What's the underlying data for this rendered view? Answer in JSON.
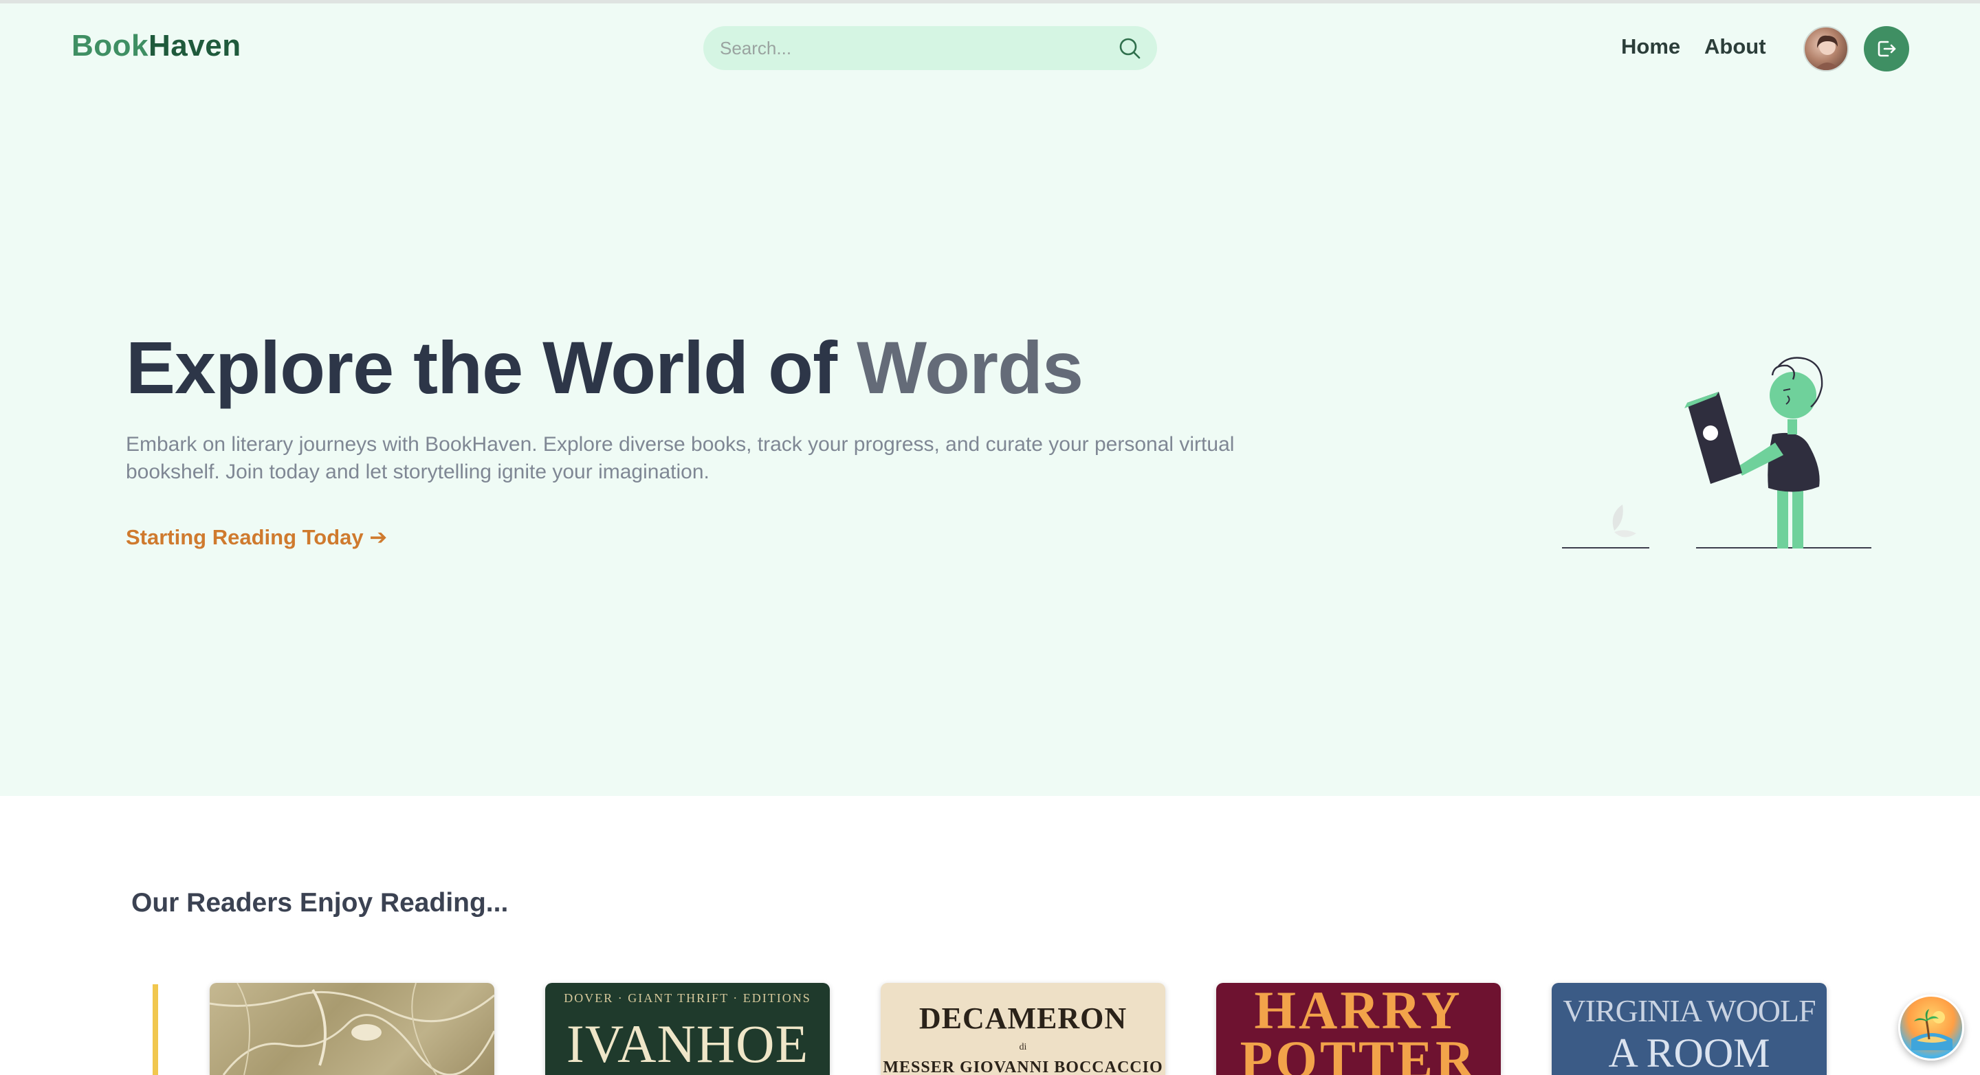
{
  "navbar": {
    "logo_part1": "Book",
    "logo_part2": "Haven",
    "search_placeholder": "Search...",
    "links": [
      {
        "label": "Home"
      },
      {
        "label": "About"
      }
    ],
    "avatar_icon": "user-avatar",
    "logout_icon": "logout-icon",
    "search_icon": "search-icon"
  },
  "hero": {
    "title_main": "Explore the World of ",
    "title_highlight": "Words",
    "description": "Embark on literary journeys with BookHaven. Explore diverse books, track your progress, and curate your personal virtual bookshelf. Join today and let storytelling ignite your imagination.",
    "cta_label": "Starting Reading Today ➔",
    "illustration": "person-reading-illustration"
  },
  "readers": {
    "title": "Our Readers Enjoy Reading...",
    "books": [
      {
        "cover_text": ""
      },
      {
        "series": "DOVER · GIANT THRIFT · EDITIONS",
        "title": "IVANHOE"
      },
      {
        "title": "DECAMERON",
        "sub": "di",
        "author": "MESSER GIOVANNI BOCCACCIO"
      },
      {
        "title": "HARRY POTTER"
      },
      {
        "author": "VIRGINIA WOOLF",
        "title": "A ROOM"
      }
    ]
  },
  "colors": {
    "brand": "#3f8f63",
    "brand_dark": "#1f5a3c",
    "hero_bg": "#effbf5",
    "cta": "#cf7a2e",
    "heading": "#2d3648"
  },
  "floating_button_icon": "beach-island-icon"
}
